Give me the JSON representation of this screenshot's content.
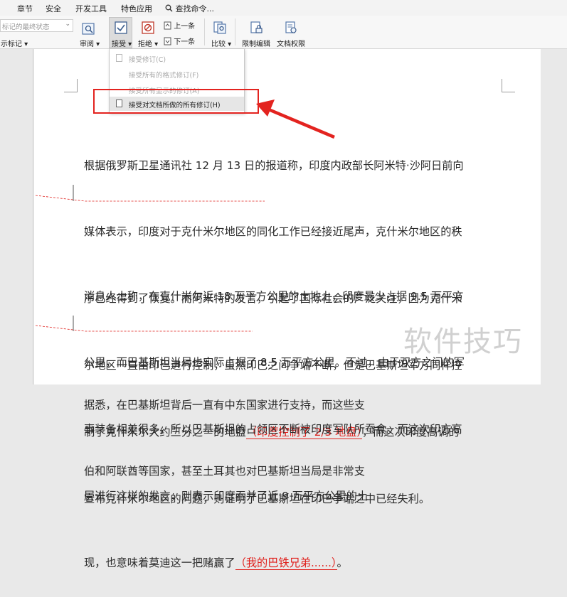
{
  "tabs": [
    "章节",
    "安全",
    "开发工具",
    "特色应用",
    "查找命令..."
  ],
  "ribbon": {
    "markup_state": "标记的最终状态",
    "show_markup": "示标记",
    "review": "审阅",
    "accept": "接受",
    "reject": "拒绝",
    "previous": "上一条",
    "next": "下一条",
    "compare": "比较",
    "restrict_edit": "限制编辑",
    "doc_permission": "文档权限"
  },
  "menu": {
    "items": [
      {
        "label": "接受修订(C)",
        "enabled": false
      },
      {
        "label": "接受所有的格式修订(F)",
        "enabled": false
      },
      {
        "label": "接受所有显示的修订(A)",
        "enabled": false
      },
      {
        "label": "接受对文档所做的所有修订(H)",
        "enabled": true
      }
    ]
  },
  "doc": {
    "p1": [
      "根据俄罗斯卫星通讯社 12 月 13 日的报道称，印度内政部长阿米特·沙阿日前向",
      "媒体表示，印度对于克什米尔地区的同化工作已经接近尾声，克什米尔地区的秩",
      "序已经得到了恢复。而阿米特的发言，引起了国际社会的广泛关注，因为克什米",
      "尔地区一直由印巴进行控制，虽然印巴之间争端不断，但是巴基斯坦军方同样控"
    ],
    "p1_l5_a": "制了克什米尔大约三分之一的地盘",
    "p1_l5_ins": "（印度控制了 2/3 地盘）",
    "p1_l5_b": "，而这次印度高调的",
    "p1_l6": "宣布克什米尔地区的问题，则证明了巴基斯坦在印巴争端之中已经失利。",
    "p2": [
      "消息人士称，在克什米尔近 18 万平方公里的土地上，印度最少占据 9.5 万平方",
      "公里，而巴基斯坦当局也实际占据了 8.5 万平方公里。不过，由于双方之间的军",
      "事装备相差很多，所以巴基斯坦的占领区不断被印度军队所蚕食。而这次印方高",
      "层进行这样的发言，则表示印度吞并了近 9 万平方公里的土"
    ],
    "p2_l5_a": "现，也意味着莫迪这一把赌赢了",
    "p2_l5_ins": "（我的巴铁兄弟......）",
    "p2_l5_b": "。",
    "p3": [
      "据悉，在巴基斯坦背后一直有中东国家进行支持，而这些支",
      "伯和阿联酋等国家，甚至土耳其也对巴基斯坦当局是非常支"
    ]
  },
  "watermark": "软件技巧",
  "colors": {
    "accent_red": "#e3231f",
    "insert_red": "#e0201c"
  }
}
